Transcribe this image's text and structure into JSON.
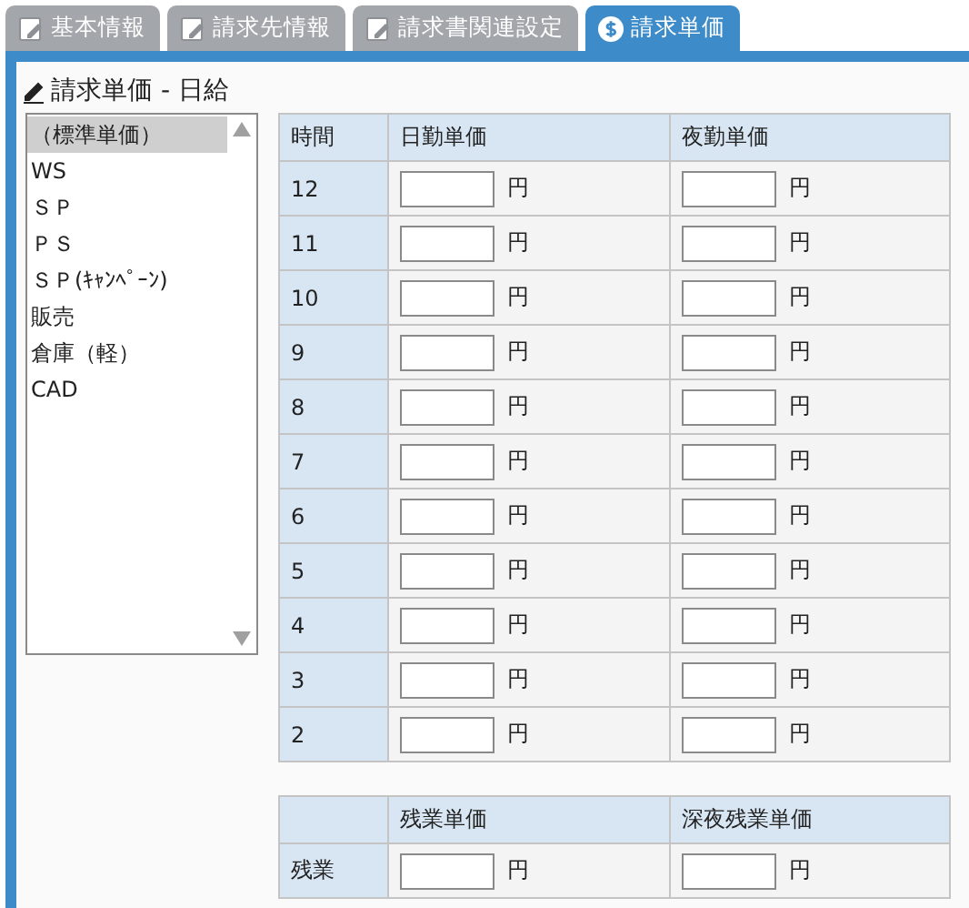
{
  "tabs": [
    {
      "label": "基本情報",
      "kind": "edit",
      "selected": false
    },
    {
      "label": "請求先情報",
      "kind": "edit",
      "selected": false
    },
    {
      "label": "請求書関連設定",
      "kind": "edit",
      "selected": false
    },
    {
      "label": "請求単価",
      "kind": "dollar",
      "selected": true
    }
  ],
  "title": "請求単価 - 日給",
  "list": [
    {
      "label": "（標準単価）",
      "selected": true
    },
    {
      "label": "WS",
      "selected": false
    },
    {
      "label": "ＳＰ",
      "selected": false
    },
    {
      "label": "ＰＳ",
      "selected": false
    },
    {
      "label": "ＳＰ(ｷｬﾝﾍﾟｰﾝ)",
      "selected": false
    },
    {
      "label": "販売",
      "selected": false
    },
    {
      "label": "倉庫（軽）",
      "selected": false
    },
    {
      "label": "CAD",
      "selected": false
    }
  ],
  "rate_table": {
    "columns": [
      "時間",
      "日勤単価",
      "夜勤単価"
    ],
    "rows": [
      {
        "hour": "12",
        "day_unit": "円",
        "night_unit": "円"
      },
      {
        "hour": "11",
        "day_unit": "円",
        "night_unit": "円"
      },
      {
        "hour": "10",
        "day_unit": "円",
        "night_unit": "円"
      },
      {
        "hour": "9",
        "day_unit": "円",
        "night_unit": "円"
      },
      {
        "hour": "8",
        "day_unit": "円",
        "night_unit": "円"
      },
      {
        "hour": "7",
        "day_unit": "円",
        "night_unit": "円"
      },
      {
        "hour": "6",
        "day_unit": "円",
        "night_unit": "円"
      },
      {
        "hour": "5",
        "day_unit": "円",
        "night_unit": "円"
      },
      {
        "hour": "4",
        "day_unit": "円",
        "night_unit": "円"
      },
      {
        "hour": "3",
        "day_unit": "円",
        "night_unit": "円"
      },
      {
        "hour": "2",
        "day_unit": "円",
        "night_unit": "円"
      }
    ]
  },
  "overtime_table": {
    "columns": [
      "残業単価",
      "深夜残業単価"
    ],
    "rows": [
      {
        "hour": "残業",
        "day_unit": "円",
        "night_unit": "円"
      }
    ]
  }
}
